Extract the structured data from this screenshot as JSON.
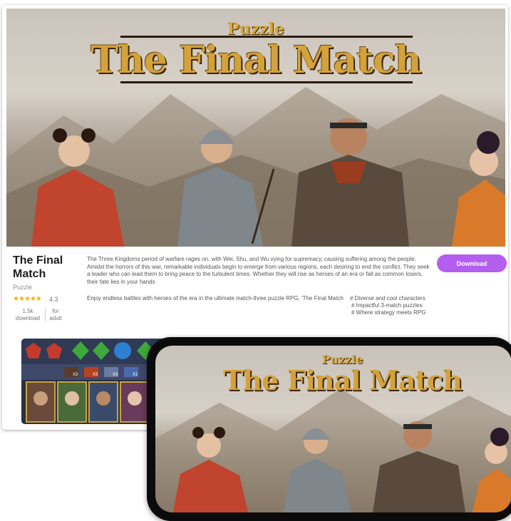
{
  "hero": {
    "subtitle": "Puzzle",
    "title": "The Final Match"
  },
  "app": {
    "name": "The Final Match",
    "genre": "Puzzle",
    "stars": "★★★★★",
    "rating": "4.3",
    "downloads_value": "1.5k",
    "downloads_label": "download",
    "age_value": "for",
    "age_label": "adult",
    "description": "The Three Kingdoms period of warfare rages on, with Wei, Shu, and Wu vying for supremacy, causing suffering among the people. Amidst the horrors of this war, remarkable individuals begin to emerge from various regions, each desiring to end the conflict. They seek a leader who can lead them to bring peace to the turbulent times. Whether they will rise as heroes of an era or fall as common losers, their fate lies in your hands",
    "tagline": "Enjoy endless battles with heroes of the era in the ultimate match-three puzzle RPG, 'The Final Match",
    "tags": [
      "# Diverse and cool characters",
      "# Impactful 3-match puzzles",
      "# Where strategy meets RPG"
    ],
    "download_label": "Download"
  },
  "thumbnail": {
    "skill_counts": [
      "X3",
      "X3",
      "X3",
      "X1"
    ]
  },
  "phone": {
    "subtitle": "Puzzle",
    "title": "The Final Match"
  },
  "colors": {
    "accent": "#b45ef0",
    "gold": "#d4a23b",
    "star": "#f0b400"
  }
}
